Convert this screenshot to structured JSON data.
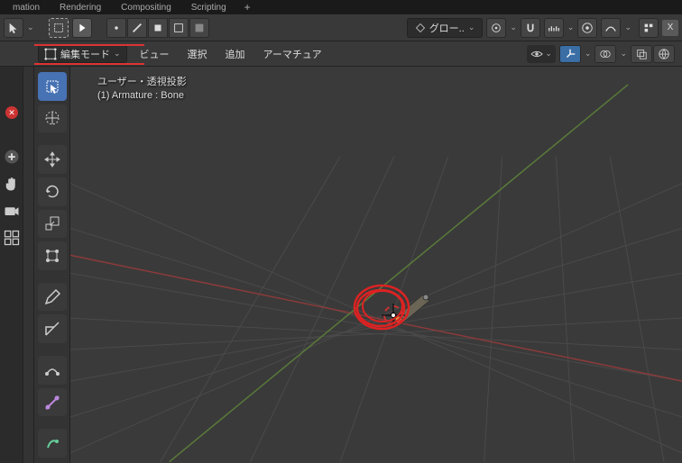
{
  "tabs": [
    "mation",
    "Rendering",
    "Compositing",
    "Scripting"
  ],
  "header": {
    "transform_dropdown": "グロー..",
    "snap_caret": "∨"
  },
  "menubar": {
    "mode": "編集モード",
    "items": [
      "ビュー",
      "選択",
      "追加",
      "アーマチュア"
    ]
  },
  "viewport": {
    "line1": "ユーザー・透視投影",
    "line2": "(1) Armature : Bone"
  },
  "icons": {
    "plus": "+",
    "x": "X",
    "chev": "⌄"
  }
}
